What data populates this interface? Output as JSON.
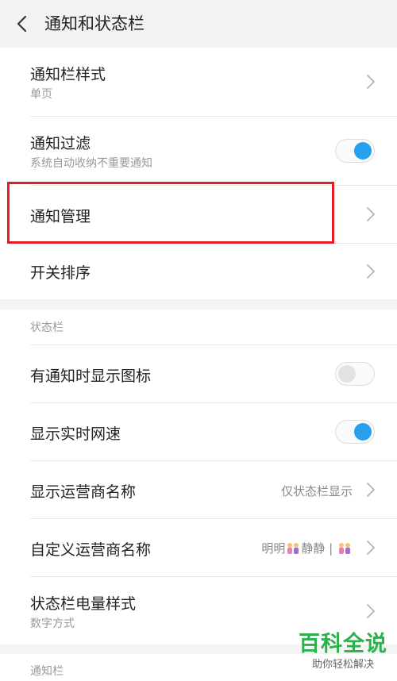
{
  "header": {
    "title": "通知和状态栏"
  },
  "notification_section": {
    "items": [
      {
        "title": "通知栏样式",
        "subtitle": "单页"
      },
      {
        "title": "通知过滤",
        "subtitle": "系统自动收纳不重要通知",
        "toggle": true
      },
      {
        "title": "通知管理"
      },
      {
        "title": "开关排序"
      }
    ]
  },
  "status_bar_section": {
    "label": "状态栏",
    "items": [
      {
        "title": "有通知时显示图标",
        "toggle": false
      },
      {
        "title": "显示实时网速",
        "toggle": true
      },
      {
        "title": "显示运营商名称",
        "value": "仅状态栏显示"
      },
      {
        "title": "自定义运营商名称",
        "value_part1": "明明",
        "value_part2": "静静 | "
      },
      {
        "title": "状态栏电量样式",
        "subtitle": "数字方式"
      }
    ]
  },
  "next_section": {
    "label": "通知栏"
  },
  "watermark": {
    "main": "百科全说",
    "sub": "助你轻松解决"
  },
  "colors": {
    "accent": "#27a0ef",
    "highlight": "#e31e24",
    "watermark": "#2bb24c"
  }
}
